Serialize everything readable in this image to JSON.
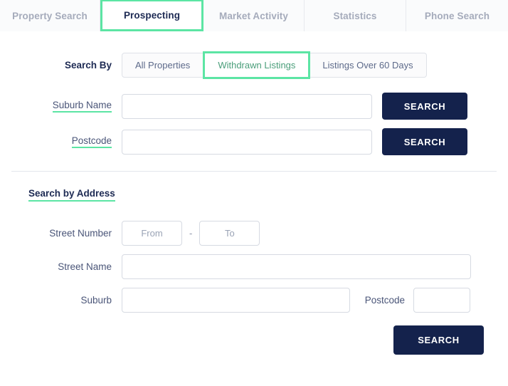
{
  "tabs": [
    {
      "label": "Property Search",
      "active": false
    },
    {
      "label": "Prospecting",
      "active": true
    },
    {
      "label": "Market Activity",
      "active": false
    },
    {
      "label": "Statistics",
      "active": false
    },
    {
      "label": "Phone Search",
      "active": false
    }
  ],
  "search_by": {
    "label": "Search By",
    "options": [
      {
        "label": "All Properties",
        "selected": false
      },
      {
        "label": "Withdrawn Listings",
        "selected": true
      },
      {
        "label": "Listings Over 60 Days",
        "selected": false
      }
    ]
  },
  "suburb_name": {
    "label": "Suburb Name",
    "value": "",
    "placeholder": "",
    "button_label": "SEARCH"
  },
  "postcode": {
    "label": "Postcode",
    "value": "",
    "placeholder": "",
    "button_label": "SEARCH"
  },
  "address_section": {
    "title": "Search by Address",
    "street_number": {
      "label": "Street Number",
      "from_value": "",
      "from_placeholder": "From",
      "separator": "-",
      "to_value": "",
      "to_placeholder": "To"
    },
    "street_name": {
      "label": "Street Name",
      "value": "",
      "placeholder": ""
    },
    "suburb": {
      "label": "Suburb",
      "value": "",
      "placeholder": ""
    },
    "postcode": {
      "label": "Postcode",
      "value": "",
      "placeholder": ""
    },
    "button_label": "SEARCH"
  },
  "colors": {
    "accent_green": "#5ce5a4",
    "navy": "#14224c",
    "tab_inactive_text": "#a5abbb",
    "tab_bg": "#fafbfc",
    "border": "#d6dae2"
  }
}
